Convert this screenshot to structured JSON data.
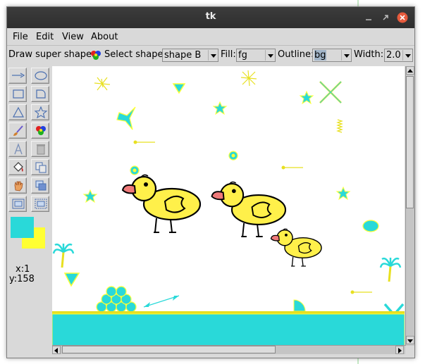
{
  "window": {
    "title": "tk"
  },
  "menubar": {
    "items": [
      "File",
      "Edit",
      "View",
      "About"
    ]
  },
  "options": {
    "draw_super_shape_label": "Draw super shape:",
    "select_shape_label": "Select shape:",
    "shape_value": "shape B",
    "fill_label": "Fill:",
    "fill_value": "fg",
    "outline_label": "Outline:",
    "outline_value": "bg",
    "width_label": "Width:",
    "width_value": "2.0"
  },
  "tools": [
    "line-arrow-icon",
    "oval-icon",
    "rectangle-icon",
    "arc-icon",
    "triangle-icon",
    "star-icon",
    "brush-icon",
    "super-shape-icon",
    "text-icon",
    "trash-icon",
    "paint-bucket-icon",
    "duplicate-icon",
    "hand-icon",
    "layer-icon",
    "group-icon",
    "ungroup-icon"
  ],
  "status": {
    "x": "x:1",
    "y": "y:158"
  },
  "colors": {
    "fill": "#ffff33",
    "outline": "#29d9d9",
    "duck_fill": "#fff04a",
    "canvas_bg": "#ffffff",
    "ground": "#29d9d9"
  }
}
